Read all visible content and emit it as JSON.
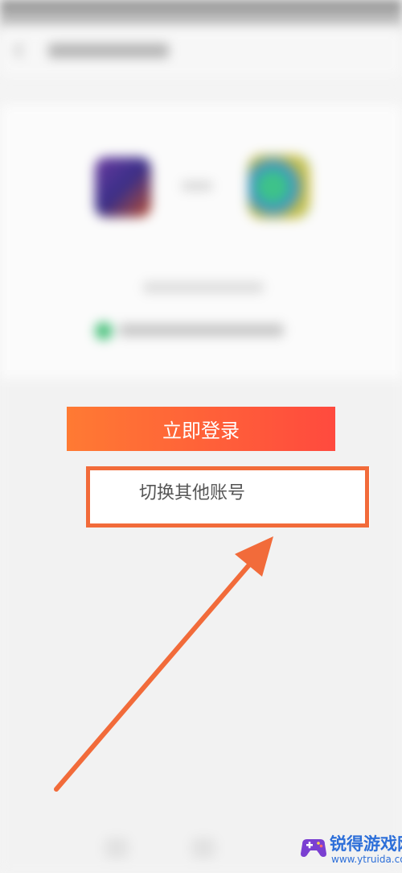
{
  "login": {
    "button_label": "立即登录",
    "switch_account_label": "切换其他账号"
  },
  "annotation": {
    "highlight_color": "#f26b3a",
    "arrow_color": "#f26b3a"
  },
  "watermark": {
    "name": "锐得游戏网",
    "url": "www.ytruida.com"
  },
  "colors": {
    "button_gradient_start": "#ff7a33",
    "button_gradient_end": "#ff4a3e"
  }
}
